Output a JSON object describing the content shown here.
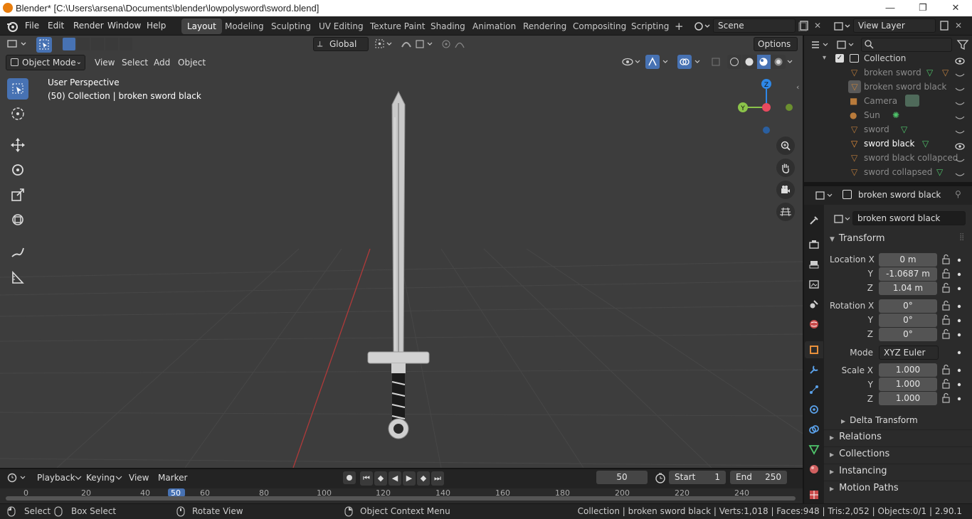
{
  "window": {
    "title": "Blender* [C:\\Users\\arsena\\Documents\\blender\\lowpolysword\\sword.blend]",
    "minimize": "—",
    "maximize": "❐",
    "close": "✕"
  },
  "menus": [
    "File",
    "Edit",
    "Render",
    "Window",
    "Help"
  ],
  "workspaces": [
    "Layout",
    "Modeling",
    "Sculpting",
    "UV Editing",
    "Texture Paint",
    "Shading",
    "Animation",
    "Rendering",
    "Compositing",
    "Scripting"
  ],
  "active_workspace": "Layout",
  "add_workspace": "+",
  "scene": "Scene",
  "view_layer": "View Layer",
  "toolheader": {
    "orientation": "Global",
    "options": "Options"
  },
  "viewport_header": {
    "mode": "Object Mode",
    "view": "View",
    "select": "Select",
    "add": "Add",
    "object": "Object"
  },
  "viewport": {
    "perspective": "User Perspective",
    "collection_info": "(50) Collection | broken sword black",
    "gizmo": {
      "z": "Z",
      "y": "Y"
    }
  },
  "outliner": {
    "search_placeholder": "",
    "collection": "Collection",
    "items": [
      {
        "name": "broken sword",
        "active": false
      },
      {
        "name": "broken sword black",
        "active": false
      },
      {
        "name": "Camera",
        "active": false
      },
      {
        "name": "Sun",
        "active": false
      },
      {
        "name": "sword",
        "active": false
      },
      {
        "name": "sword black",
        "active": true
      },
      {
        "name": "sword black collapced",
        "active": false
      },
      {
        "name": "sword collapsed",
        "active": false
      }
    ]
  },
  "properties": {
    "context_name": "broken sword black",
    "object_name": "broken sword black",
    "transform_label": "Transform",
    "location": {
      "label": "Location X",
      "x": "0 m",
      "y": "-1.0687 m",
      "z": "1.04 m"
    },
    "rotation": {
      "label": "Rotation X",
      "x": "0°",
      "y": "0°",
      "z": "0°"
    },
    "mode_label": "Mode",
    "mode_value": "XYZ Euler",
    "scale": {
      "label": "Scale X",
      "x": "1.000",
      "y": "1.000",
      "z": "1.000"
    },
    "axis_y": "Y",
    "axis_z": "Z",
    "delta_transform": "Delta Transform",
    "panels": [
      "Relations",
      "Collections",
      "Instancing",
      "Motion Paths"
    ]
  },
  "timeline": {
    "playback": "Playback",
    "keying": "Keying",
    "view": "View",
    "marker": "Marker",
    "current_frame": "50",
    "start_label": "Start",
    "start": "1",
    "end_label": "End",
    "end": "250",
    "ticks": [
      "0",
      "20",
      "40",
      "50",
      "60",
      "80",
      "100",
      "120",
      "140",
      "160",
      "180",
      "200",
      "220",
      "240"
    ]
  },
  "statusbar": {
    "select": "Select",
    "box_select": "Box Select",
    "rotate_view": "Rotate View",
    "context_menu": "Object Context Menu",
    "stats": "Collection | broken sword black | Verts:1,018 | Faces:948 | Tris:2,052 | Objects:0/1 | 2.90.1"
  },
  "colors": {
    "accent": "#4772b3",
    "object_orange": "#e8903b",
    "mesh_green": "#4fc46b",
    "gizmo_x": "#e84a5f",
    "gizmo_y": "#8bc34a",
    "gizmo_z": "#2e88e8"
  }
}
